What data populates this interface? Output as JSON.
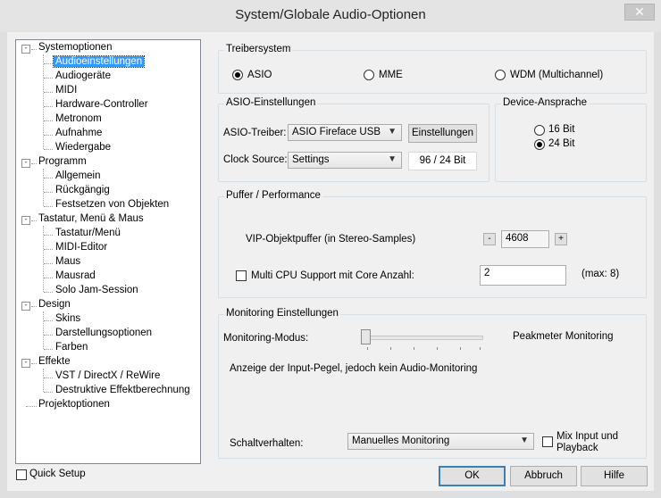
{
  "window": {
    "title": "System/Globale Audio-Optionen",
    "close_glyph": "✕"
  },
  "tree": [
    {
      "label": "Systemoptionen",
      "expanded": true,
      "children": [
        "Audioeinstellungen",
        "Audiogeräte",
        "MIDI",
        "Hardware-Controller",
        "Metronom",
        "Aufnahme",
        "Wiedergabe"
      ]
    },
    {
      "label": "Programm",
      "expanded": true,
      "children": [
        "Allgemein",
        "Rückgängig",
        "Festsetzen von Objekten"
      ]
    },
    {
      "label": "Tastatur, Menü & Maus",
      "expanded": true,
      "children": [
        "Tastatur/Menü",
        "MIDI-Editor",
        "Maus",
        "Mausrad",
        "Solo Jam-Session"
      ]
    },
    {
      "label": "Design",
      "expanded": true,
      "children": [
        "Skins",
        "Darstellungsoptionen",
        "Farben"
      ]
    },
    {
      "label": "Effekte",
      "expanded": true,
      "children": [
        "VST / DirectX / ReWire",
        "Destruktive Effektberechnung"
      ]
    },
    {
      "label": "Projektoptionen",
      "expanded": false,
      "children": []
    }
  ],
  "selected_item": "Audioeinstellungen",
  "quick_setup": {
    "label": "Quick Setup",
    "checked": false
  },
  "treibersystem": {
    "title": "Treibersystem",
    "options": [
      {
        "label": "ASIO",
        "selected": true
      },
      {
        "label": "MME",
        "selected": false
      },
      {
        "label": "WDM (Multichannel)",
        "selected": false
      }
    ]
  },
  "asio": {
    "title": "ASIO-Einstellungen",
    "driver_label": "ASIO-Treiber:",
    "driver_value": "ASIO Fireface USB",
    "settings_button": "Einstellungen",
    "clock_label": "Clock Source:",
    "clock_value": "Settings",
    "format_value": "96 / 24 Bit"
  },
  "device": {
    "title": "Device-Ansprache",
    "options": [
      {
        "label": "16 Bit",
        "selected": false
      },
      {
        "label": "24 Bit",
        "selected": true
      }
    ]
  },
  "puffer": {
    "title": "Puffer / Performance",
    "vip_label": "VIP-Objektpuffer (in Stereo-Samples)",
    "minus": "-",
    "vip_value": "4608",
    "plus": "+",
    "multicpu_label": "Multi CPU Support mit Core Anzahl:",
    "multicpu_checked": false,
    "core_value": "2",
    "max_text": "(max: 8)"
  },
  "monitoring": {
    "title": "Monitoring Einstellungen",
    "mode_label": "Monitoring-Modus:",
    "slider_value": 0,
    "mode_value": "Peakmeter Monitoring",
    "description": "Anzeige der Input-Pegel, jedoch kein Audio-Monitoring",
    "schalt_label": "Schaltverhalten:",
    "schalt_value": "Manuelles Monitoring",
    "mix_label_1": "Mix Input und",
    "mix_label_2": "Playback",
    "mix_checked": false
  },
  "buttons": {
    "ok": "OK",
    "cancel": "Abbruch",
    "help": "Hilfe"
  },
  "icons": {
    "dropdown": "chevron-down-icon",
    "expand": "minus-icon"
  }
}
